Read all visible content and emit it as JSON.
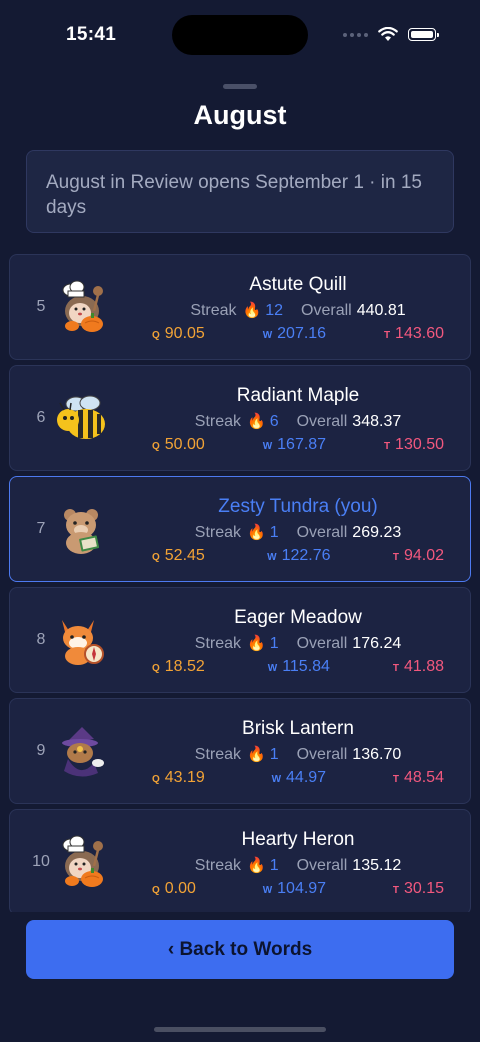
{
  "status_bar": {
    "time": "15:41"
  },
  "header": {
    "title": "August"
  },
  "notice": {
    "text": "August in Review opens September 1 · in 15 days"
  },
  "labels": {
    "streak": "Streak",
    "overall": "Overall",
    "q_key": "Q",
    "w_key": "W",
    "t_key": "T"
  },
  "players": [
    {
      "rank": "5",
      "name": "Astute Quill",
      "streak": "12",
      "overall": "440.81",
      "q": "90.05",
      "w": "207.16",
      "t": "143.60",
      "avatar": "chef-hedgehog-pumpkin"
    },
    {
      "rank": "6",
      "name": "Radiant Maple",
      "streak": "6",
      "overall": "348.37",
      "q": "50.00",
      "w": "167.87",
      "t": "130.50",
      "avatar": "bee"
    },
    {
      "rank": "7",
      "name": "Zesty Tundra (you)",
      "streak": "1",
      "overall": "269.23",
      "q": "52.45",
      "w": "122.76",
      "t": "94.02",
      "avatar": "bear-reading-book"
    },
    {
      "rank": "8",
      "name": "Eager Meadow",
      "streak": "1",
      "overall": "176.24",
      "q": "18.52",
      "w": "115.84",
      "t": "41.88",
      "avatar": "fox-compass"
    },
    {
      "rank": "9",
      "name": "Brisk Lantern",
      "streak": "1",
      "overall": "136.70",
      "q": "43.19",
      "w": "44.97",
      "t": "48.54",
      "avatar": "wizard-fox"
    },
    {
      "rank": "10",
      "name": "Hearty Heron",
      "streak": "1",
      "overall": "135.12",
      "q": "0.00",
      "w": "104.97",
      "t": "30.15",
      "avatar": "chef-hedgehog-pumpkin"
    }
  ],
  "footer": {
    "back_label": "‹ Back to Words"
  },
  "colors": {
    "background": "#141a33",
    "card": "#1c2342",
    "accent": "#3d6df0",
    "q": "#f2a336",
    "w": "#4a7ff5",
    "t": "#f2587e"
  }
}
